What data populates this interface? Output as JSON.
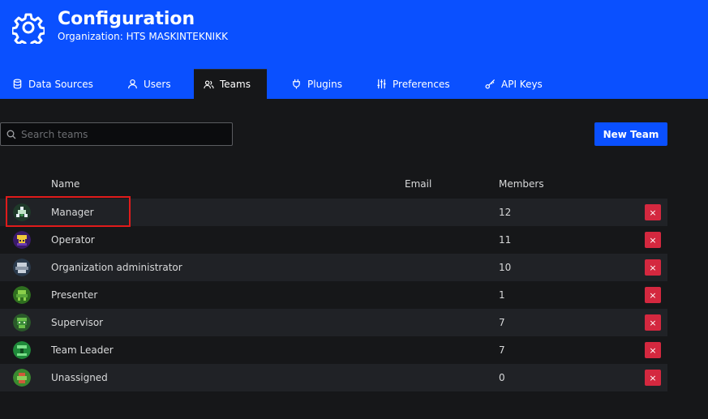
{
  "header": {
    "title": "Configuration",
    "subtitle": "Organization: HTS MASKINTEKNIKK",
    "bg_color": "#0a50ff"
  },
  "tabs": [
    {
      "label": "Data Sources",
      "icon": "database-icon",
      "active": false
    },
    {
      "label": "Users",
      "icon": "user-icon",
      "active": false
    },
    {
      "label": "Teams",
      "icon": "users-icon",
      "active": true
    },
    {
      "label": "Plugins",
      "icon": "plug-icon",
      "active": false
    },
    {
      "label": "Preferences",
      "icon": "sliders-icon",
      "active": false
    },
    {
      "label": "API Keys",
      "icon": "key-icon",
      "active": false
    }
  ],
  "search": {
    "placeholder": "Search teams",
    "value": ""
  },
  "new_team_label": "New Team",
  "table": {
    "columns": [
      "Name",
      "Email",
      "Members"
    ],
    "rows": [
      {
        "name": "Manager",
        "email": "",
        "members": "12",
        "avatar_color": "#2b7a2b"
      },
      {
        "name": "Operator",
        "email": "",
        "members": "11",
        "avatar_color": "#5b2b9a"
      },
      {
        "name": "Organization administrator",
        "email": "",
        "members": "10",
        "avatar_color": "#3a4a5c"
      },
      {
        "name": "Presenter",
        "email": "",
        "members": "1",
        "avatar_color": "#3f8f2f"
      },
      {
        "name": "Supervisor",
        "email": "",
        "members": "7",
        "avatar_color": "#3a7a3a"
      },
      {
        "name": "Team Leader",
        "email": "",
        "members": "7",
        "avatar_color": "#2fa84a"
      },
      {
        "name": "Unassigned",
        "email": "",
        "members": "0",
        "avatar_color": "#3f9a3f"
      }
    ],
    "delete_label": "×"
  },
  "accent_colors": {
    "primary": "#0a50ff",
    "danger": "#d4283f",
    "highlight": "#e01b1b"
  }
}
